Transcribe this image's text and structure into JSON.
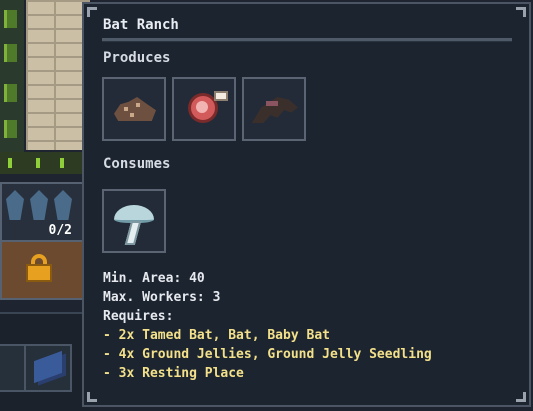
{
  "scene": {
    "worker_count": "0/2"
  },
  "tooltip": {
    "title": "Bat Ranch",
    "produces_label": "Produces",
    "produces_items": [
      {
        "icon": "guano-icon"
      },
      {
        "icon": "meat-icon"
      },
      {
        "icon": "bat-wing-icon"
      }
    ],
    "consumes_label": "Consumes",
    "consumes_items": [
      {
        "icon": "mushroom-icon"
      }
    ],
    "min_area": "Min. Area: 40",
    "max_workers": "Max. Workers: 3",
    "requires_label": "Requires:",
    "requirements": [
      "- 2x Tamed Bat, Bat, Baby Bat",
      "- 4x Ground Jellies, Ground Jelly Seedling",
      "- 3x Resting Place"
    ]
  },
  "colors": {
    "panel_bg": "#1c2430",
    "panel_border": "#4b5563",
    "title_text": "#e9edf2",
    "requirement_text": "#f2e08a"
  }
}
